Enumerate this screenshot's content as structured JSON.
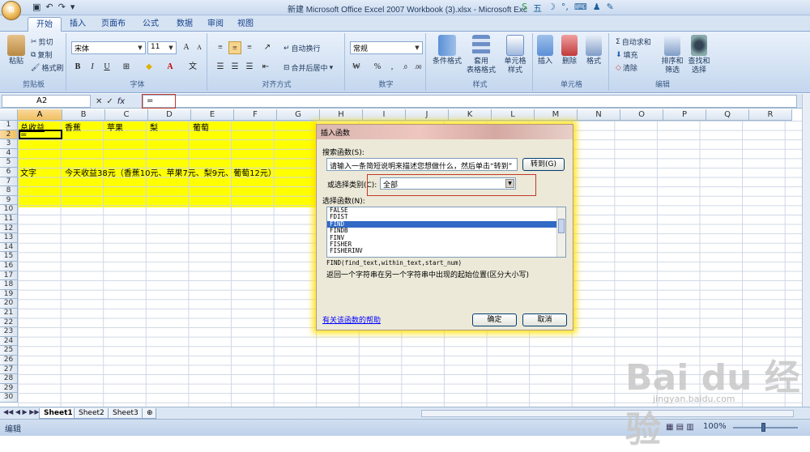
{
  "window": {
    "title": "新建 Microsoft Office Excel 2007 Workbook (3).xlsx - Microsoft Exc"
  },
  "tabs": [
    "开始",
    "插入",
    "页面布局",
    "公式",
    "数据",
    "审阅",
    "视图"
  ],
  "tray": {
    "ime_label": "五"
  },
  "ribbon": {
    "clipboard": {
      "label": "剪贴板",
      "paste": "粘贴",
      "cut": "剪切",
      "copy": "复制",
      "painter": "格式刷"
    },
    "font": {
      "label": "字体",
      "name": "宋体",
      "size": "11"
    },
    "alignment": {
      "label": "对齐方式",
      "wrap": "自动换行",
      "merge": "合并后居中"
    },
    "number": {
      "label": "数字",
      "format": "常规"
    },
    "styles": {
      "label": "样式",
      "cond": "条件格式",
      "table": "套用\n表格格式",
      "cell": "单元格\n样式"
    },
    "cells": {
      "label": "单元格",
      "insert": "插入",
      "delete": "删除",
      "format": "格式"
    },
    "editing": {
      "label": "编辑",
      "autosum": "自动求和",
      "fill": "填充",
      "clear": "清除",
      "sort": "排序和\n筛选",
      "find": "查找和\n选择"
    }
  },
  "formula_bar": {
    "name_box": "A2",
    "formula": "="
  },
  "columns": [
    "A",
    "B",
    "C",
    "D",
    "E",
    "F",
    "G",
    "H",
    "I",
    "J",
    "K",
    "L",
    "M",
    "N",
    "O",
    "P",
    "Q",
    "R"
  ],
  "rows": [
    "1",
    "2",
    "3",
    "4",
    "5",
    "6",
    "7",
    "8",
    "9",
    "10",
    "11",
    "12",
    "13",
    "14",
    "15",
    "16",
    "17",
    "18",
    "19",
    "20",
    "21",
    "22",
    "23",
    "24",
    "25",
    "26",
    "27",
    "28",
    "29",
    "30"
  ],
  "cells": {
    "A1": "总收益",
    "B1": "香蕉",
    "C1": "苹果",
    "D1": "梨",
    "E1": "葡萄",
    "A2": "=",
    "A5": "文字",
    "B5": "今天收益38元（香蕉10元、苹果7元、梨9元、葡萄12元）"
  },
  "dialog": {
    "title": "插入函数",
    "search_label": "搜索函数(S):",
    "search_value": "请输入一条简短说明来描述您想做什么，然后单击“转到”",
    "go_button": "转到(G)",
    "category_label": "或选择类别(C):",
    "category_value": "全部",
    "select_label": "选择函数(N):",
    "functions": [
      "FALSE",
      "FDIST",
      "FIND",
      "FINDB",
      "FINV",
      "FISHER",
      "FISHERINV"
    ],
    "selected_function": "FIND",
    "signature": "FIND(find_text,within_text,start_num)",
    "description": "返回一个字符串在另一个字符串中出现的起始位置(区分大小写)",
    "help_link": "有关该函数的帮助",
    "ok": "确定",
    "cancel": "取消"
  },
  "sheets": [
    "Sheet1",
    "Sheet2",
    "Sheet3"
  ],
  "status": {
    "mode": "编辑",
    "zoom": "100%"
  },
  "watermark": {
    "brand": "Bai du 经验",
    "url": "jingyan.baidu.com"
  }
}
